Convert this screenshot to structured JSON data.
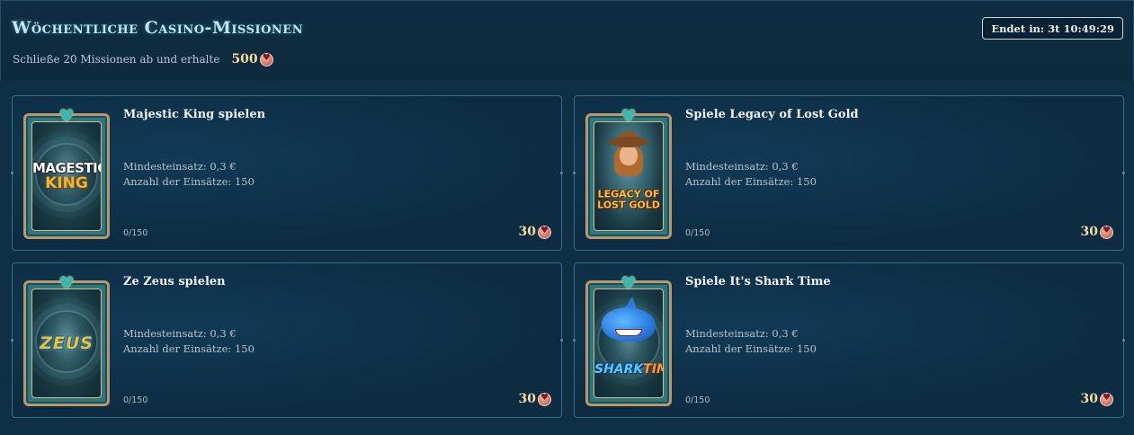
{
  "header": {
    "title": "Wöchentliche Casino-Missionen",
    "subtitle": "Schließe 20 Missionen ab und erhalte",
    "total_reward": "500",
    "timer": "Endet in: 3t 10:49:29"
  },
  "missions": [
    {
      "title": "Majestic King spielen",
      "min_bet": "Mindesteinsatz: 0,3 €",
      "bet_count": "Anzahl der Einsätze: 150",
      "progress": "0/150",
      "reward": "30",
      "logo_line1": "MAGESTIC",
      "logo_line2": "KING"
    },
    {
      "title": "Spiele Legacy of Lost Gold",
      "min_bet": "Mindesteinsatz: 0,3 €",
      "bet_count": "Anzahl der Einsätze: 150",
      "progress": "0/150",
      "reward": "30",
      "logo_line1": "LEGACY OF",
      "logo_line2": "LOST GOLD"
    },
    {
      "title": "Ze Zeus spielen",
      "min_bet": "Mindesteinsatz: 0,3 €",
      "bet_count": "Anzahl der Einsätze: 150",
      "progress": "0/150",
      "reward": "30",
      "logo_line1": "ZEUS"
    },
    {
      "title": "Spiele It's Shark Time",
      "min_bet": "Mindesteinsatz: 0,3 €",
      "bet_count": "Anzahl der Einsätze: 150",
      "progress": "0/150",
      "reward": "30",
      "logo_line1": "SHARK",
      "logo_line2": "TIME!"
    }
  ],
  "icons": {
    "reward_coin": "heart-coin-icon",
    "frame_top": "heart-icon"
  },
  "colors": {
    "background": "#0c2638",
    "card_border": "#3b6a82",
    "reward_text": "#f2dca0",
    "title_glow": "#bfe6f2",
    "frame_gold": "#b9976a",
    "frame_teal": "#2b7880"
  }
}
